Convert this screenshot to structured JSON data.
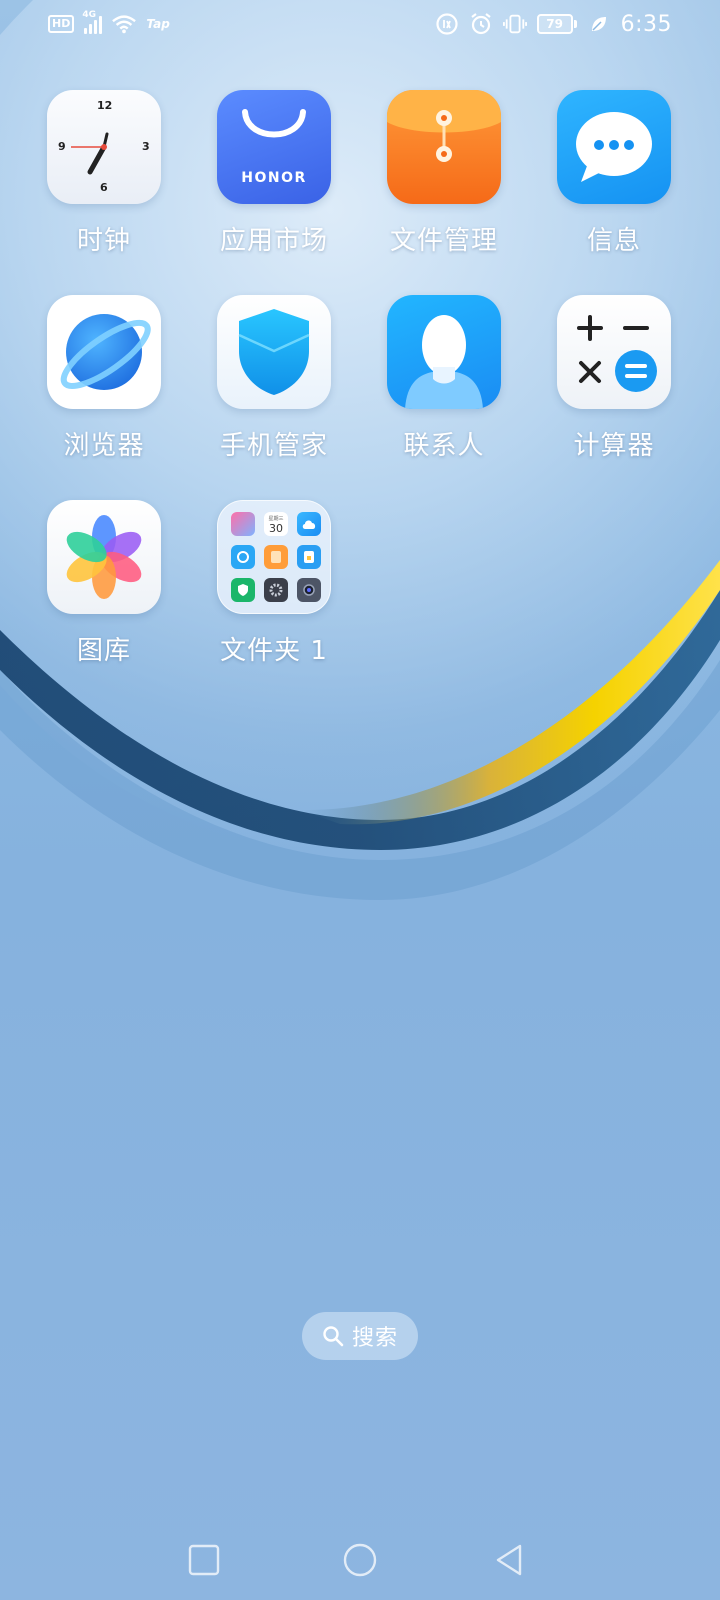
{
  "status_bar": {
    "hd": "HD",
    "network": "4G",
    "tap": "Tap",
    "battery": "79",
    "time": "6:35",
    "icons": [
      "hd-icon",
      "signal-icon",
      "wifi-icon",
      "nfc-sync-icon",
      "alarm-icon",
      "vibrate-icon",
      "battery-icon",
      "leaf-saver-icon"
    ]
  },
  "apps": [
    {
      "id": "clock",
      "label": "时钟",
      "icon": "clock-icon"
    },
    {
      "id": "app-market",
      "label": "应用市场",
      "icon": "shopping-bag-icon",
      "brand_text": "HONOR"
    },
    {
      "id": "file-manager",
      "label": "文件管理",
      "icon": "file-envelope-icon"
    },
    {
      "id": "messages",
      "label": "信息",
      "icon": "chat-bubble-icon"
    },
    {
      "id": "browser",
      "label": "浏览器",
      "icon": "planet-icon"
    },
    {
      "id": "phone-manager",
      "label": "手机管家",
      "icon": "shield-icon"
    },
    {
      "id": "contacts",
      "label": "联系人",
      "icon": "person-icon"
    },
    {
      "id": "calculator",
      "label": "计算器",
      "icon": "calculator-icon"
    },
    {
      "id": "gallery",
      "label": "图库",
      "icon": "flower-icon"
    },
    {
      "id": "folder",
      "label": "文件夹 1",
      "icon": "folder-icon"
    }
  ],
  "clock_face": {
    "n12": "12",
    "n3": "3",
    "n6": "6",
    "n9": "9"
  },
  "folder_preview": {
    "calendar_day": "30",
    "calendar_header": "星期三"
  },
  "search": {
    "label": "搜索"
  },
  "nav_bar": {
    "buttons": [
      "recent-apps",
      "home",
      "back"
    ]
  },
  "colors": {
    "market_blue": "#3a62e6",
    "files_orange": "#f56a18",
    "messages_blue": "#1592f2",
    "contacts_blue": "#1a8cf3",
    "wallpaper_blue": "#8bb9e2",
    "wave_gold": "#f2c500"
  }
}
